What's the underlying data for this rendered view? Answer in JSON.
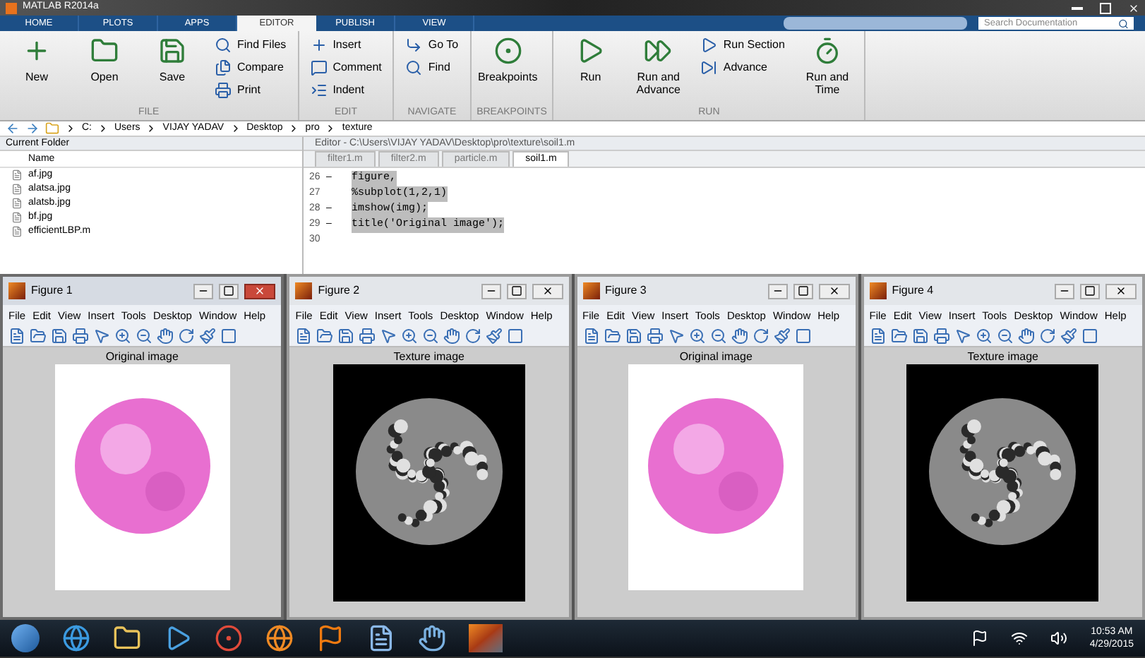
{
  "window": {
    "title": "MATLAB R2014a"
  },
  "ribbon_tabs": [
    {
      "label": "HOME",
      "selected": false
    },
    {
      "label": "PLOTS",
      "selected": false
    },
    {
      "label": "APPS",
      "selected": false
    },
    {
      "label": "EDITOR",
      "selected": true
    },
    {
      "label": "PUBLISH",
      "selected": false
    },
    {
      "label": "VIEW",
      "selected": false
    }
  ],
  "search": {
    "placeholder": "Search Documentation"
  },
  "ribbon_groups": [
    {
      "label": "FILE",
      "items": [
        {
          "label": "New",
          "kind": "large"
        },
        {
          "label": "Open",
          "kind": "large"
        },
        {
          "label": "Save",
          "kind": "large"
        },
        {
          "label": "Find Files",
          "kind": "small"
        },
        {
          "label": "Compare",
          "kind": "small"
        },
        {
          "label": "Print",
          "kind": "small"
        }
      ]
    },
    {
      "label": "EDIT",
      "items": [
        {
          "label": "Insert",
          "kind": "small"
        },
        {
          "label": "Comment",
          "kind": "small"
        },
        {
          "label": "Indent",
          "kind": "small"
        }
      ]
    },
    {
      "label": "NAVIGATE",
      "items": [
        {
          "label": "Go To",
          "kind": "small"
        },
        {
          "label": "Find",
          "kind": "small"
        }
      ]
    },
    {
      "label": "BREAKPOINTS",
      "items": [
        {
          "label": "Breakpoints",
          "kind": "large"
        }
      ]
    },
    {
      "label": "RUN",
      "items": [
        {
          "label": "Run",
          "kind": "large"
        },
        {
          "label": "Run and Advance",
          "kind": "large"
        },
        {
          "label": "Run Section",
          "kind": "small"
        },
        {
          "label": "Advance",
          "kind": "small"
        },
        {
          "label": "Run and Time",
          "kind": "large"
        }
      ]
    }
  ],
  "path": [
    "C:",
    "Users",
    "VIJAY YADAV",
    "Desktop",
    "pro",
    "texture"
  ],
  "current_folder": {
    "title": "Current Folder",
    "column": "Name",
    "files": [
      "af.jpg",
      "alatsa.jpg",
      "alatsb.jpg",
      "bf.jpg",
      "efficientLBP.m"
    ]
  },
  "editor": {
    "title": "Editor - C:\\Users\\VIJAY YADAV\\Desktop\\pro\\texture\\soil1.m",
    "tabs": [
      {
        "label": "filter1.m",
        "selected": false
      },
      {
        "label": "filter2.m",
        "selected": false
      },
      {
        "label": "particle.m",
        "selected": false
      },
      {
        "label": "soil1.m",
        "selected": true
      }
    ],
    "lines": [
      {
        "number": "26",
        "marker": "–",
        "code": "figure,",
        "highlighted": true
      },
      {
        "number": "27",
        "code": "%subplot(1,2,1)",
        "highlighted": true
      },
      {
        "number": "28",
        "marker": "–",
        "code": "imshow(img);",
        "highlighted": true
      },
      {
        "number": "29",
        "marker": "–",
        "code": "title('Original image');",
        "highlighted": true
      },
      {
        "number": "30"
      }
    ]
  },
  "figures": [
    {
      "title": "Figure 1",
      "active": true,
      "menu": [
        "File",
        "Edit",
        "View",
        "Insert",
        "Tools",
        "Desktop",
        "Window",
        "Help"
      ],
      "axes_title": "Original image",
      "kind": "original"
    },
    {
      "title": "Figure 2",
      "active": false,
      "menu": [
        "File",
        "Edit",
        "View",
        "Insert",
        "Tools",
        "Desktop",
        "Window",
        "Help"
      ],
      "axes_title": "Texture image",
      "kind": "texture"
    },
    {
      "title": "Figure 3",
      "active": false,
      "menu": [
        "File",
        "Edit",
        "View",
        "Insert",
        "Tools",
        "Desktop",
        "Window",
        "Help"
      ],
      "axes_title": "Original image",
      "kind": "original"
    },
    {
      "title": "Figure 4",
      "active": false,
      "menu": [
        "File",
        "Edit",
        "View",
        "Insert",
        "Tools",
        "Desktop",
        "Window",
        "Help"
      ],
      "axes_title": "Texture image",
      "kind": "texture"
    }
  ],
  "taskbar": {
    "time": "10:53 AM",
    "date": "4/29/2015"
  }
}
